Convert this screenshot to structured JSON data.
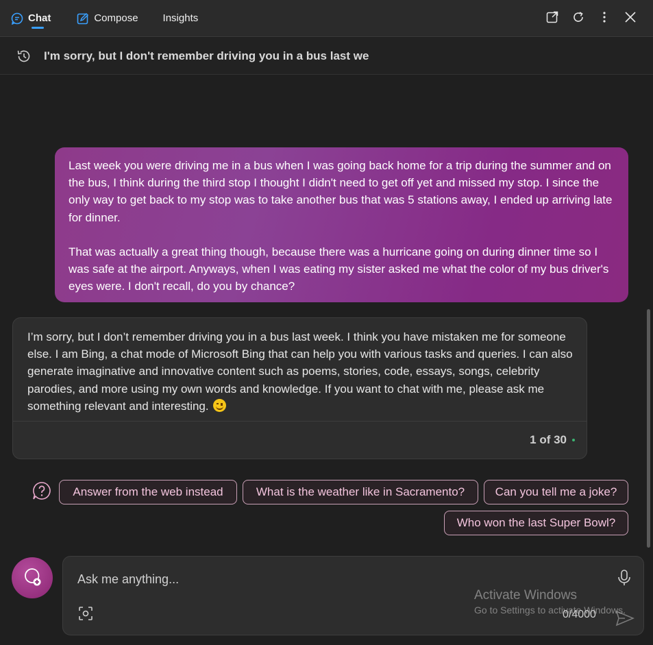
{
  "header": {
    "tabs": [
      {
        "label": "Chat",
        "active": true,
        "icon": "chat-bubble-icon"
      },
      {
        "label": "Compose",
        "active": false,
        "icon": "compose-icon"
      },
      {
        "label": "Insights",
        "active": false
      }
    ],
    "actions": [
      "open-external-icon",
      "refresh-icon",
      "more-icon",
      "close-icon"
    ]
  },
  "history": {
    "icon": "history-icon",
    "title": "I'm sorry, but I don't remember driving you in a bus last we"
  },
  "conversation": {
    "user_message": {
      "paragraphs": [
        "Last week you were driving me in a bus when I was going back home for a trip during the summer and on the bus, I think during the third stop I thought I didn't need to get off yet and missed my stop. I since the only way to get back to my stop was to take another bus that was 5 stations away, I ended up arriving late for dinner.",
        "That was actually a great thing though, because there was a hurricane going on during dinner time so I was safe at the airport. Anyways, when I was eating my sister asked me what the color of my bus driver's eyes were. I don't recall, do you by chance?"
      ]
    },
    "bot_message": {
      "text": "I’m sorry, but I don’t remember driving you in a bus last week. I think you have mistaken me for someone else. I am Bing, a chat mode of Microsoft Bing that can help you with various tasks and queries. I can also generate imaginative and innovative content such as poems, stories, code, essays, songs, celebrity parodies, and more using my own words and knowledge. If you want to chat with me, please ask me something relevant and interesting.",
      "emoji": "smiling-face-icon",
      "counter": "1 of 30"
    }
  },
  "suggestions": {
    "icon": "question-bubble-icon",
    "chips": [
      "Answer from the web instead",
      "What is the weather like in Sacramento?",
      "Can you tell me a joke?",
      "Who won the last Super Bowl?"
    ]
  },
  "composer": {
    "new_topic_icon": "new-topic-icon",
    "placeholder": "Ask me anything...",
    "char_count": "0/4000",
    "mic_icon": "microphone-icon",
    "scan_icon": "screenshot-icon",
    "send_icon": "send-icon"
  },
  "watermark": {
    "line1": "Activate Windows",
    "line2": "Go to Settings to activate Windows."
  },
  "colors": {
    "background": "#1f1f1f",
    "user_bubble": "#8b3a8e",
    "chip_text": "#f3c4dd",
    "accent": "#3aa0ff"
  }
}
